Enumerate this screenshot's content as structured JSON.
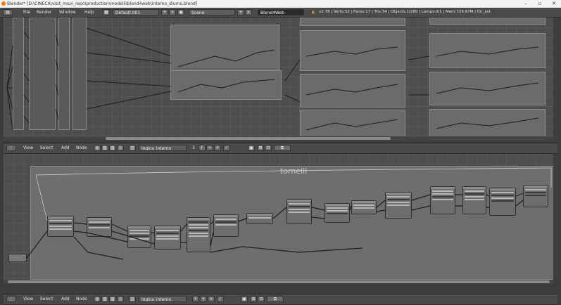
{
  "window": {
    "title": "Blender* [D:\\CINECA\\visit_muvi_repo\\production\\modelli\\blend4web\\interno_diurno.blend]",
    "controls": [
      "–",
      "▫",
      "✕"
    ]
  },
  "info_header": {
    "menus": [
      "File",
      "Render",
      "Window",
      "Help"
    ],
    "screen_layout": "Default.001",
    "scene": "Scene",
    "engine": "Blend4Web",
    "stats": "v2.78 | Verts:52 | Faces:17 | Tris:34 | Objects:1/280 | Lamps:0/1 | Mem:729.67M | Dir_est"
  },
  "top_editor": {},
  "middle_header": {
    "menus": [
      "View",
      "Select",
      "Add",
      "Node"
    ],
    "node_tree": "logica_interno",
    "users": "3",
    "fake_user": "F"
  },
  "bottom_editor": {
    "frame_label": "tornelli"
  },
  "bottom_header": {
    "menus": [
      "View",
      "Select",
      "Add",
      "Node"
    ],
    "node_tree": "logica_interno",
    "fake_user": "F"
  }
}
